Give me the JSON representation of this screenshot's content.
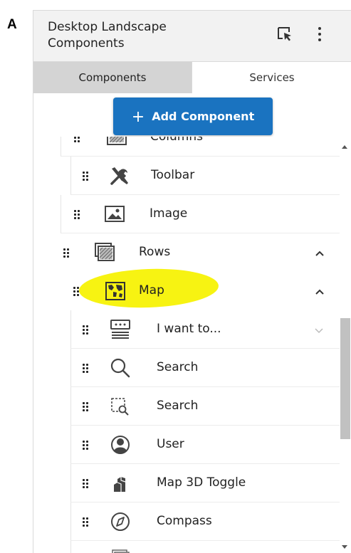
{
  "figure_label": "A",
  "header": {
    "title": "Desktop Landscape Components"
  },
  "tabs": [
    {
      "label": "Components",
      "active": true
    },
    {
      "label": "Services",
      "active": false
    }
  ],
  "add_button": {
    "icon": "+",
    "label": "Add Component"
  },
  "tree": {
    "items": [
      {
        "label": "Columns",
        "icon": "columns-icon"
      },
      {
        "label": "Toolbar",
        "icon": "toolbar-icon"
      },
      {
        "label": "Image",
        "icon": "image-icon"
      },
      {
        "label": "Rows",
        "icon": "rows-icon",
        "expanded": true
      },
      {
        "label": "Map",
        "icon": "map-icon",
        "expanded": true,
        "highlighted": true
      },
      {
        "label": "I want to...",
        "icon": "i-want-to-icon"
      },
      {
        "label": "Search",
        "icon": "search-icon"
      },
      {
        "label": "Search",
        "icon": "region-search-icon"
      },
      {
        "label": "User",
        "icon": "user-icon"
      },
      {
        "label": "Map 3D Toggle",
        "icon": "map-3d-toggle-icon"
      },
      {
        "label": "Compass",
        "icon": "compass-icon"
      }
    ]
  },
  "colors": {
    "accent": "#1a73c0",
    "highlight": "#f7f205",
    "active_tab": "#d4d4d4",
    "header_bg": "#f2f2f2"
  }
}
